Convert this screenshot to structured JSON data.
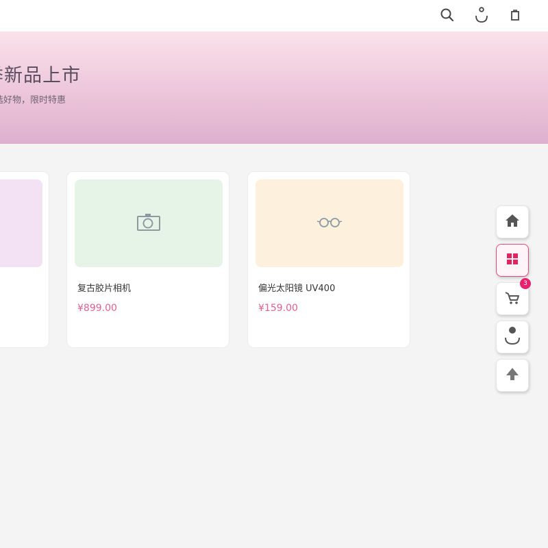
{
  "header": {
    "icons": [
      "search-icon",
      "user-icon",
      "shopping-bag-icon"
    ]
  },
  "hero": {
    "title": "季新品上市",
    "subtitle": "选好物，限时特惠",
    "colors": {
      "top": "#fae2ea",
      "bottom": "#ddb0cf"
    }
  },
  "products": [
    {
      "name": "",
      "price": "",
      "thumb_color": "#f3e2f3",
      "icon": "product-icon"
    },
    {
      "name": "复古胶片相机",
      "price": "¥899.00",
      "thumb_color": "#e6f4e7",
      "icon": "camera-icon"
    },
    {
      "name": "偏光太阳镜 UV400",
      "price": "¥159.00",
      "thumb_color": "#fdf0dd",
      "icon": "glasses-icon"
    }
  ],
  "side_nav": {
    "items": [
      {
        "name": "home",
        "icon": "home-icon",
        "active": false
      },
      {
        "name": "category",
        "icon": "grid-icon",
        "active": true
      },
      {
        "name": "cart",
        "icon": "cart-icon",
        "active": false,
        "badge": "3"
      },
      {
        "name": "profile",
        "icon": "user-icon",
        "active": false
      },
      {
        "name": "back-to-top",
        "icon": "arrow-up-icon",
        "active": false
      }
    ]
  },
  "colors": {
    "accent": "#e24c7c",
    "price": "#e0608f",
    "badge": "#e8206e",
    "background": "#f4f4f4"
  }
}
